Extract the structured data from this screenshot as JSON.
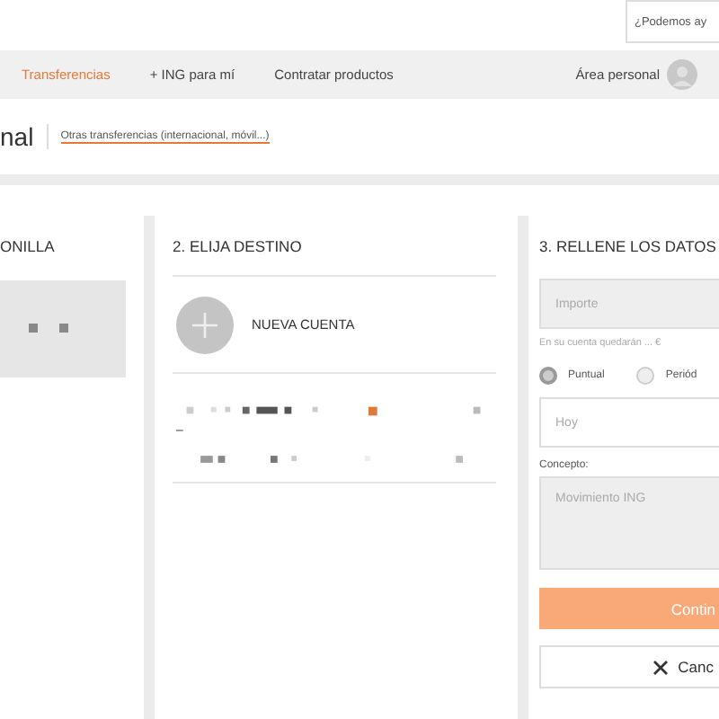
{
  "help_field": {
    "placeholder": "¿Podemos ay"
  },
  "nav": {
    "tabs": [
      {
        "label": "Transferencias",
        "selected": true
      },
      {
        "label": "+ ING para mí",
        "selected": false
      },
      {
        "label": "Contratar productos",
        "selected": false
      }
    ],
    "account": {
      "label": "Área personal"
    }
  },
  "subheader": {
    "title": "nal",
    "link": "Otras transferencias (internacional, móvil...)"
  },
  "columns": {
    "origin": {
      "heading": "ONILLA"
    },
    "destination": {
      "heading": "2. ELIJA DESTINO",
      "new_account": "NUEVA CUENTA"
    },
    "details": {
      "heading": "3. RELLENE LOS DATOS",
      "amount": {
        "placeholder": "Importe"
      },
      "balance_hint": "En su cuenta quedarán ... €",
      "frequency": [
        {
          "label": "Puntual",
          "selected": true
        },
        {
          "label": "Periód",
          "selected": false
        }
      ],
      "date": {
        "placeholder": "Hoy"
      },
      "concept_label": "Concepto:",
      "concept": {
        "placeholder": "Movimiento ING"
      },
      "continue": "Contin",
      "cancel": "Canc"
    }
  }
}
